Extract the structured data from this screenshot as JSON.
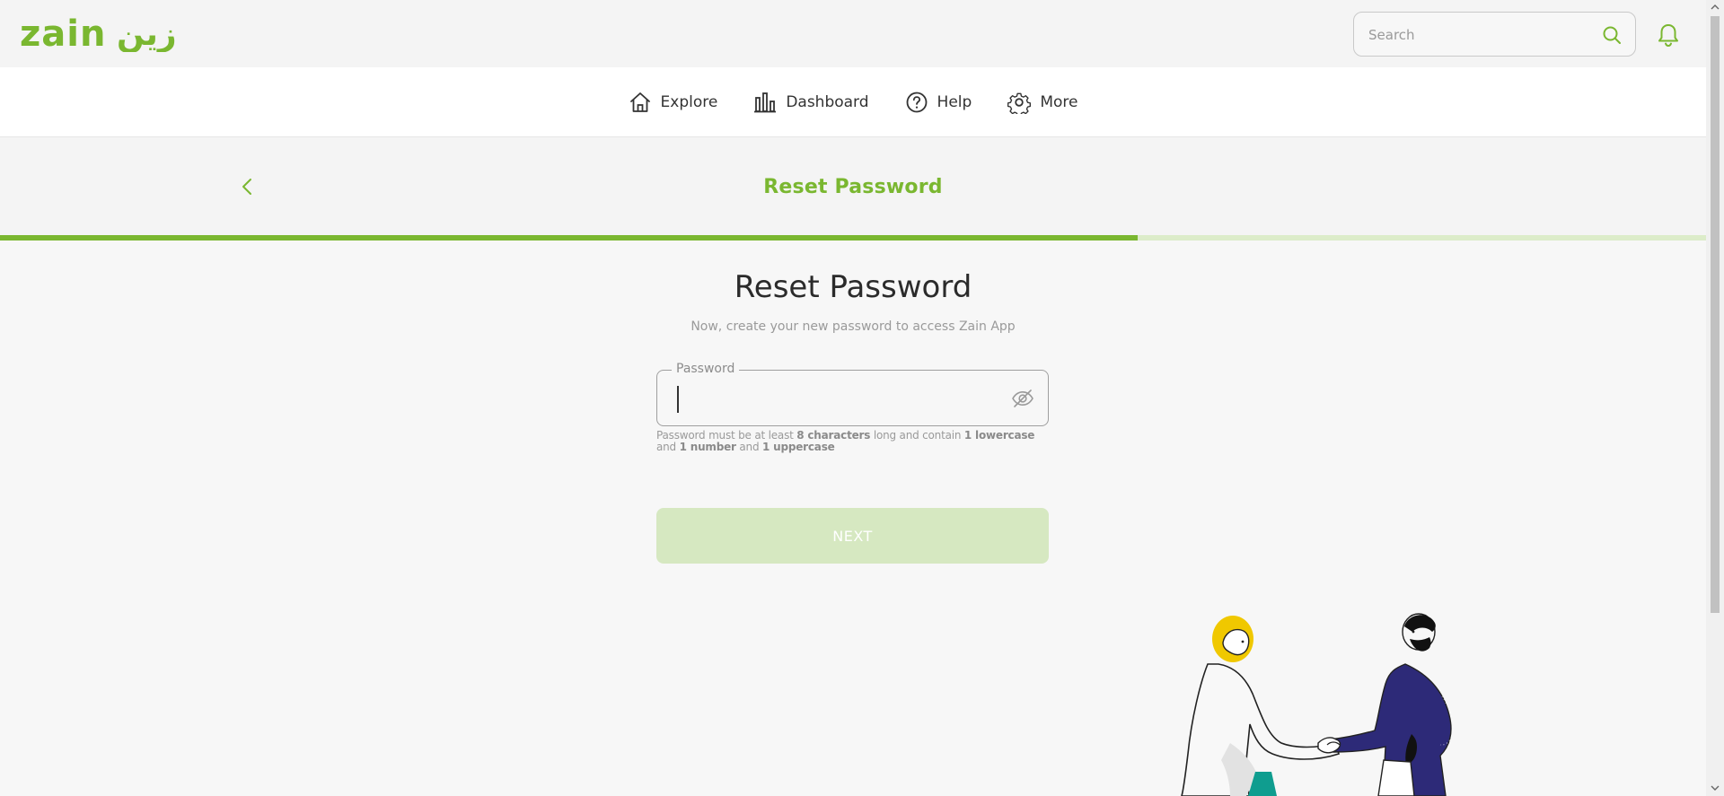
{
  "brand": {
    "logo_text": "zain",
    "logo_arabic": "زين",
    "accent": "#7ab730"
  },
  "search": {
    "placeholder": "Search",
    "icon": "search-icon"
  },
  "header": {
    "notification_icon": "bell-icon"
  },
  "nav": {
    "items": [
      {
        "label": "Explore",
        "icon": "home-icon"
      },
      {
        "label": "Dashboard",
        "icon": "bar-chart-icon"
      },
      {
        "label": "Help",
        "icon": "question-circle-icon"
      },
      {
        "label": "More",
        "icon": "gear-icon"
      }
    ]
  },
  "page_header": {
    "title": "Reset Password",
    "back_icon": "chevron-left-icon"
  },
  "progress": {
    "fraction": 0.667
  },
  "form": {
    "title": "Reset Password",
    "subtitle": "Now, create your new password to access Zain App",
    "password_label": "Password",
    "password_value": "",
    "hint_1": "Password must be at least ",
    "hint_b1": "8 characters",
    "hint_2": " long and contain ",
    "hint_b2": "1 lowercase",
    "hint_3": " and ",
    "hint_b3": "1 number",
    "hint_4": " and ",
    "hint_b4": "1 uppercase",
    "next_label": "NEXT"
  }
}
